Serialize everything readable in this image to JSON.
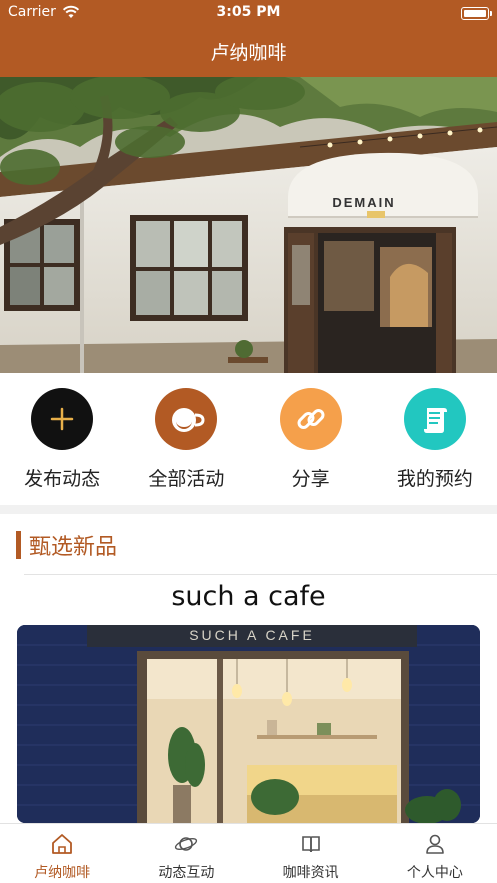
{
  "status_bar": {
    "carrier": "Carrier",
    "time": "3:05 PM"
  },
  "nav": {
    "title": "卢纳咖啡"
  },
  "banner": {
    "sign_text": "DEMAIN"
  },
  "quick_actions": [
    {
      "label": "发布动态",
      "icon": "plus-icon",
      "color": "#111111"
    },
    {
      "label": "全部活动",
      "icon": "coffee-cup-icon",
      "color": "#b25a24"
    },
    {
      "label": "分享",
      "icon": "link-icon",
      "color": "#f5a04b"
    },
    {
      "label": "我的预约",
      "icon": "scroll-icon",
      "color": "#22c7c0"
    }
  ],
  "section": {
    "title": "甄选新品"
  },
  "product": {
    "name": "such a cafe",
    "sign_text": "SUCH A CAFE"
  },
  "tabbar": [
    {
      "label": "卢纳咖啡",
      "icon": "home-icon",
      "active": true
    },
    {
      "label": "动态互动",
      "icon": "planet-icon",
      "active": false
    },
    {
      "label": "咖啡资讯",
      "icon": "book-icon",
      "active": false
    },
    {
      "label": "个人中心",
      "icon": "person-icon",
      "active": false
    }
  ],
  "colors": {
    "brand": "#b25a24",
    "tab_active": "#b25a24",
    "tab_inactive": "#333333"
  }
}
